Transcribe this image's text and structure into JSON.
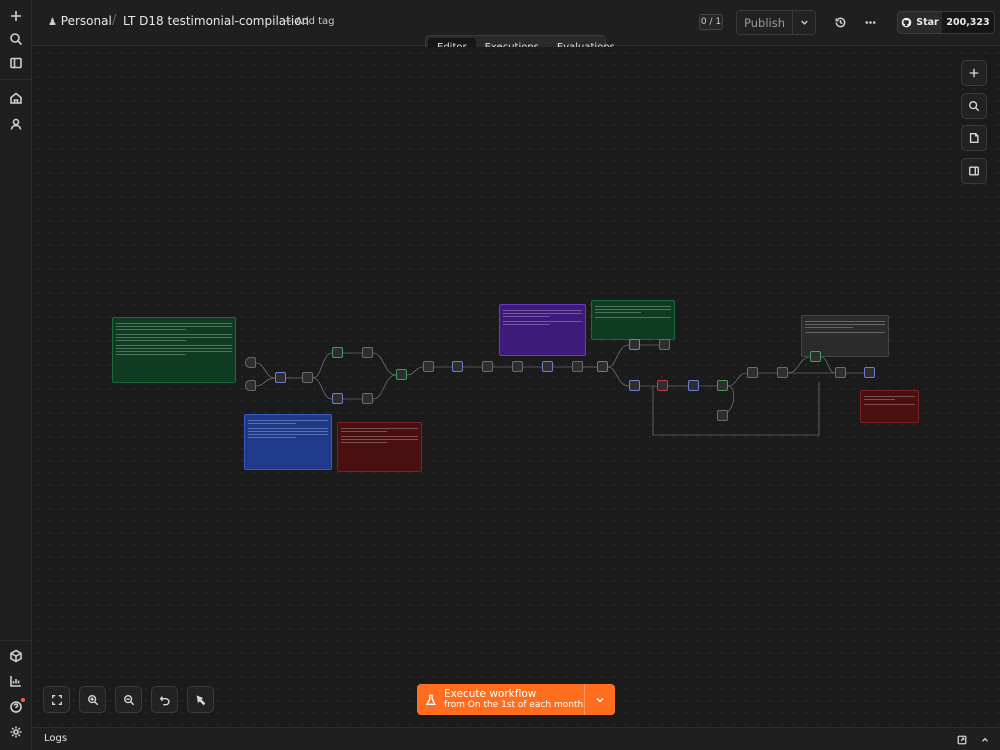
{
  "header": {
    "project": "Personal",
    "workflow_name": "LT D18 testimonial-compilation",
    "add_tag": "+ Add tag",
    "version_badge": "0 / 1",
    "publish_label": "Publish",
    "github_star": "Star",
    "github_count": "200,323"
  },
  "tabs": [
    {
      "label": "Editor",
      "active": true
    },
    {
      "label": "Executions",
      "active": false
    },
    {
      "label": "Evaluations",
      "active": false
    }
  ],
  "execute": {
    "title": "Execute workflow",
    "subtitle": "from On the 1st of each month"
  },
  "logs": {
    "label": "Logs"
  },
  "colors": {
    "accent": "#ff6d1f",
    "note_green": "#0e3b22",
    "note_blue": "#1f3a8a",
    "note_red": "#4a0f0f",
    "note_purple": "#3e1a7a",
    "note_gray": "#2b2b2b"
  },
  "icons": {
    "rail": [
      "plus-icon",
      "search-icon",
      "sidebar-icon",
      "home-icon",
      "user-icon",
      "cube-icon",
      "chart-icon",
      "help-icon",
      "settings-icon"
    ],
    "canvas_tools": [
      "zoom-to-fit-icon",
      "zoom-in-icon",
      "zoom-out-icon",
      "undo-icon",
      "sweep-icon"
    ],
    "right_tools": [
      "plus-icon",
      "search-icon",
      "sticky-note-icon",
      "panel-icon"
    ]
  }
}
